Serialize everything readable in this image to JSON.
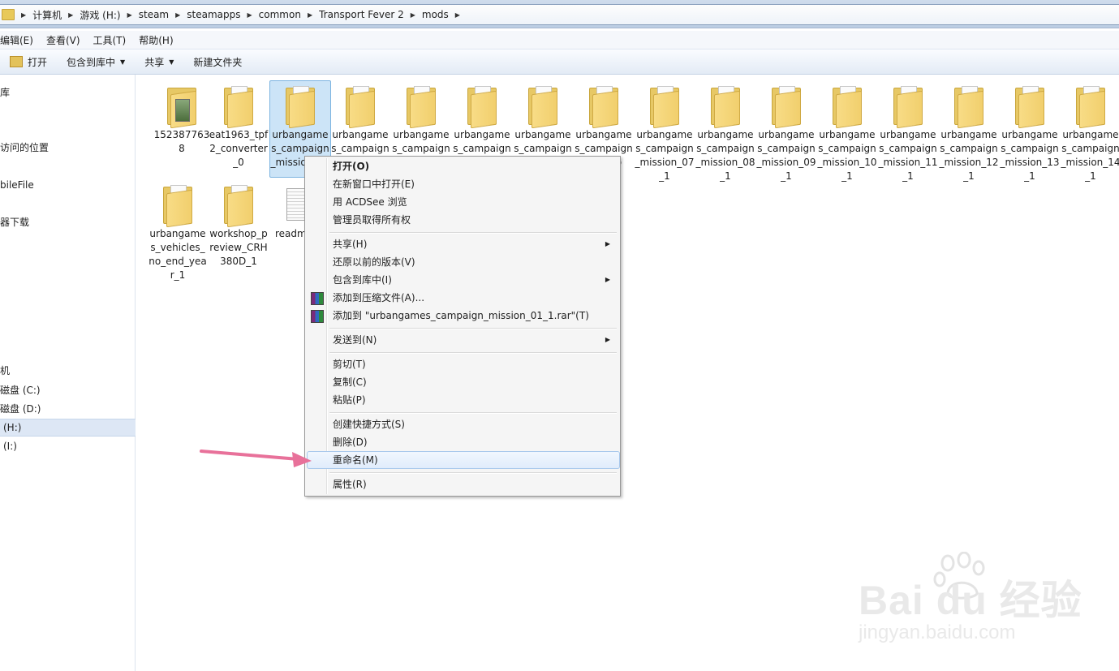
{
  "breadcrumb": [
    "计算机",
    "游戏 (H:)",
    "steam",
    "steamapps",
    "common",
    "Transport Fever 2",
    "mods"
  ],
  "menubar": [
    "编辑(E)",
    "查看(V)",
    "工具(T)",
    "帮助(H)"
  ],
  "toolbar": {
    "open": "打开",
    "include_library": "包含到库中",
    "share": "共享",
    "new_folder": "新建文件夹"
  },
  "nav": {
    "items": [
      "库",
      "访问的位置",
      "bileFile",
      "器下载",
      "机",
      "磁盘 (C:)",
      "磁盘 (D:)",
      "(H:)",
      "(I:)"
    ]
  },
  "files": [
    {
      "name": "1523877638",
      "type": "image-folder"
    },
    {
      "name": "eat1963_tpf2_converter_0",
      "type": "folder"
    },
    {
      "name": "urbangames_campaign_mission_01",
      "type": "folder",
      "selected": true
    },
    {
      "name": "urbangames_campaign_missio",
      "type": "folder"
    },
    {
      "name": "urbangames_campaign_missio",
      "type": "folder"
    },
    {
      "name": "urbangames_campaign_missio",
      "type": "folder"
    },
    {
      "name": "urbangames_campaign_missio",
      "type": "folder"
    },
    {
      "name": "urbangames_campaign_missio",
      "type": "folder"
    },
    {
      "name": "urbangames_campaign_mission_07_1",
      "type": "folder"
    },
    {
      "name": "urbangames_campaign_mission_08_1",
      "type": "folder"
    },
    {
      "name": "urbangames_campaign_mission_09_1",
      "type": "folder"
    },
    {
      "name": "urbangames_campaign_mission_10_1",
      "type": "folder"
    },
    {
      "name": "urbangames_campaign_mission_11_1",
      "type": "folder"
    },
    {
      "name": "urbangames_campaign_mission_12_1",
      "type": "folder"
    },
    {
      "name": "urbangames_campaign_mission_13_1",
      "type": "folder"
    },
    {
      "name": "urbangames_campaign_mission_14_1",
      "type": "folder"
    },
    {
      "name": "urbangames_vehicles_no_end_year_1",
      "type": "folder"
    },
    {
      "name": "workshop_preview_CRH380D_1",
      "type": "folder"
    },
    {
      "name": "readm",
      "type": "text"
    }
  ],
  "context_menu": {
    "open": "打开(O)",
    "open_new_window": "在新窗口中打开(E)",
    "acdsee": "用 ACDSee 浏览",
    "take_ownership": "管理员取得所有权",
    "share": "共享(H)",
    "restore": "还原以前的版本(V)",
    "include_library": "包含到库中(I)",
    "add_archive": "添加到压缩文件(A)...",
    "add_rar": "添加到 \"urbangames_campaign_mission_01_1.rar\"(T)",
    "send_to": "发送到(N)",
    "cut": "剪切(T)",
    "copy": "复制(C)",
    "paste": "粘贴(P)",
    "create_shortcut": "创建快捷方式(S)",
    "delete": "删除(D)",
    "rename": "重命名(M)",
    "properties": "属性(R)"
  },
  "watermark": {
    "logo": "Bai du 经验",
    "url": "jingyan.baidu.com"
  },
  "colors": {
    "selection": "#cce4f7",
    "arrow": "#e8719a",
    "folder": "#f1cf6d"
  }
}
